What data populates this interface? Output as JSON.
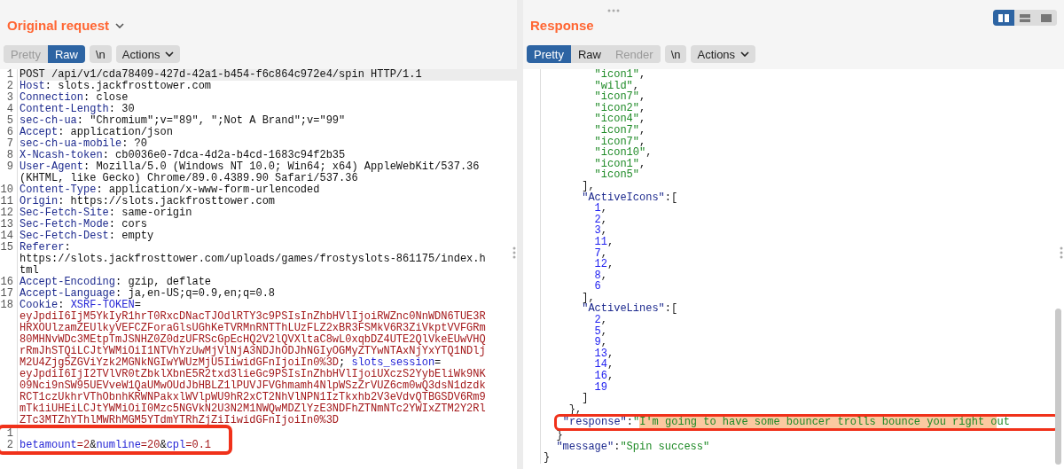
{
  "request": {
    "title": "Original request",
    "tabs": [
      {
        "label": "Pretty",
        "selected": false,
        "disabled": true
      },
      {
        "label": "Raw",
        "selected": true,
        "disabled": false
      }
    ],
    "newline_button": "\\n",
    "actions_button": "Actions",
    "lines": [
      {
        "number": "1",
        "current": true,
        "visual_lines": [
          {
            "segments": [
              {
                "kind": "plain",
                "text": "POST /api/v1/cda78409-427d-42a1-b454-f6c864c972e4/spin HTTP/1.1"
              }
            ]
          }
        ]
      },
      {
        "number": "2",
        "current": false,
        "visual_lines": [
          {
            "segments": [
              {
                "kind": "name",
                "text": "Host"
              },
              {
                "kind": "plain",
                "text": ": slots.jackfrosttower.com"
              }
            ]
          }
        ]
      },
      {
        "number": "3",
        "current": false,
        "visual_lines": [
          {
            "segments": [
              {
                "kind": "name",
                "text": "Connection"
              },
              {
                "kind": "plain",
                "text": ": close"
              }
            ]
          }
        ]
      },
      {
        "number": "4",
        "current": false,
        "visual_lines": [
          {
            "segments": [
              {
                "kind": "name",
                "text": "Content-Length"
              },
              {
                "kind": "plain",
                "text": ": 30"
              }
            ]
          }
        ]
      },
      {
        "number": "5",
        "current": false,
        "visual_lines": [
          {
            "segments": [
              {
                "kind": "name",
                "text": "sec-ch-ua"
              },
              {
                "kind": "plain",
                "text": ": \"Chromium\";v=\"89\", \";Not A Brand\";v=\"99\""
              }
            ]
          }
        ]
      },
      {
        "number": "6",
        "current": false,
        "visual_lines": [
          {
            "segments": [
              {
                "kind": "name",
                "text": "Accept"
              },
              {
                "kind": "plain",
                "text": ": application/json"
              }
            ]
          }
        ]
      },
      {
        "number": "7",
        "current": false,
        "visual_lines": [
          {
            "segments": [
              {
                "kind": "name",
                "text": "sec-ch-ua-mobile"
              },
              {
                "kind": "plain",
                "text": ": ?0"
              }
            ]
          }
        ]
      },
      {
        "number": "8",
        "current": false,
        "visual_lines": [
          {
            "segments": [
              {
                "kind": "name",
                "text": "X-Ncash-token"
              },
              {
                "kind": "plain",
                "text": ": cb0036e0-7dca-4d2a-b4cd-1683c94f2b35"
              }
            ]
          }
        ]
      },
      {
        "number": "9",
        "current": false,
        "visual_lines": [
          {
            "segments": [
              {
                "kind": "name",
                "text": "User-Agent"
              },
              {
                "kind": "plain",
                "text": ": Mozilla/5.0 (Windows NT 10.0; Win64; x64) AppleWebKit/537.36"
              }
            ]
          },
          {
            "segments": [
              {
                "kind": "plain",
                "text": "(KHTML, like Gecko) Chrome/89.0.4389.90 Safari/537.36"
              }
            ]
          }
        ]
      },
      {
        "number": "10",
        "current": false,
        "visual_lines": [
          {
            "segments": [
              {
                "kind": "name",
                "text": "Content-Type"
              },
              {
                "kind": "plain",
                "text": ": application/x-www-form-urlencoded"
              }
            ]
          }
        ]
      },
      {
        "number": "11",
        "current": false,
        "visual_lines": [
          {
            "segments": [
              {
                "kind": "name",
                "text": "Origin"
              },
              {
                "kind": "plain",
                "text": ": https://slots.jackfrosttower.com"
              }
            ]
          }
        ]
      },
      {
        "number": "12",
        "current": false,
        "visual_lines": [
          {
            "segments": [
              {
                "kind": "name",
                "text": "Sec-Fetch-Site"
              },
              {
                "kind": "plain",
                "text": ": same-origin"
              }
            ]
          }
        ]
      },
      {
        "number": "13",
        "current": false,
        "visual_lines": [
          {
            "segments": [
              {
                "kind": "name",
                "text": "Sec-Fetch-Mode"
              },
              {
                "kind": "plain",
                "text": ": cors"
              }
            ]
          }
        ]
      },
      {
        "number": "14",
        "current": false,
        "visual_lines": [
          {
            "segments": [
              {
                "kind": "name",
                "text": "Sec-Fetch-Dest"
              },
              {
                "kind": "plain",
                "text": ": empty"
              }
            ]
          }
        ]
      },
      {
        "number": "15",
        "current": false,
        "visual_lines": [
          {
            "segments": [
              {
                "kind": "name",
                "text": "Referer"
              },
              {
                "kind": "plain",
                "text": ":"
              }
            ]
          },
          {
            "segments": [
              {
                "kind": "plain",
                "text": "https://slots.jackfrosttower.com/uploads/games/frostyslots-861175/index.h"
              }
            ]
          },
          {
            "segments": [
              {
                "kind": "plain",
                "text": "tml"
              }
            ]
          }
        ]
      },
      {
        "number": "16",
        "current": false,
        "visual_lines": [
          {
            "segments": [
              {
                "kind": "name",
                "text": "Accept-Encoding"
              },
              {
                "kind": "plain",
                "text": ": gzip, deflate"
              }
            ]
          }
        ]
      },
      {
        "number": "17",
        "current": false,
        "visual_lines": [
          {
            "segments": [
              {
                "kind": "name",
                "text": "Accept-Language"
              },
              {
                "kind": "plain",
                "text": ": ja,en-US;q=0.9,en;q=0.8"
              }
            ]
          }
        ]
      },
      {
        "number": "18",
        "current": false,
        "visual_lines": [
          {
            "segments": [
              {
                "kind": "name",
                "text": "Cookie"
              },
              {
                "kind": "plain",
                "text": ": "
              },
              {
                "kind": "param",
                "text": "XSRF-TOKEN"
              },
              {
                "kind": "plain",
                "text": "="
              }
            ]
          },
          {
            "segments": [
              {
                "kind": "value",
                "text": "eyJpdiI6IjM5YkIyR1hrT0RxcDNacTJOdlRTY3c9PSIsInZhbHVlIjoiRWZnc0NnWDN6TUE3R"
              }
            ]
          },
          {
            "segments": [
              {
                "kind": "value",
                "text": "HRXOUlzamZEUlkyVEFCZForaGlsUGhKeTVRMnRNTThLUzFLZ2xBR3FSMkV6R3ZiVkptVVFGRm"
              }
            ]
          },
          {
            "segments": [
              {
                "kind": "value",
                "text": "80MHNvWDc3MEtpTmJSNHZ0Z0dzUFRScGpEcHQ2V2lQVXltaC8wL0xqbDZ4UTE2QlVkeEUwVHQ"
              }
            ]
          },
          {
            "segments": [
              {
                "kind": "value",
                "text": "rRmJhSTQiLCJtYWMiOiI1NTVhYzUwMjVlNjA3NDJhODJhNGIyOGMyZTYwNTAxNjYxYTQ1NDlj"
              }
            ]
          },
          {
            "segments": [
              {
                "kind": "value",
                "text": "M2U4Zjg5ZGViYzk2MGNkNGIwYWUzMjU5IiwidGFnIjoiIn0%3D"
              },
              {
                "kind": "plain",
                "text": "; "
              },
              {
                "kind": "param",
                "text": "slots_session"
              },
              {
                "kind": "plain",
                "text": "="
              }
            ]
          },
          {
            "segments": [
              {
                "kind": "value",
                "text": "eyJpdiI6IjI2TVlVR0tZbklXbnE5R2txd3lieGc9PSIsInZhbHVlIjoiUXczS2YybEliWk9NK"
              }
            ]
          },
          {
            "segments": [
              {
                "kind": "value",
                "text": "09Nci9nSW95UEVveW1QaUMwOUdJbHBLZ1lPUVJFVGhmamh4NlpWSzZrVUZ6cm0wQ3dsN1dzdk"
              }
            ]
          },
          {
            "segments": [
              {
                "kind": "value",
                "text": "RCT1czUkhrVThObnhKRWNPakxlWVlpWU9hR2xCT2NhVlNPN1IzTkxhb2V3eVdvQTBGSDV6Rm9"
              }
            ]
          },
          {
            "segments": [
              {
                "kind": "value",
                "text": "mTk1iUHEiLCJtYWMiOiI0Mzc5NGVkN2U3N2M1NWQwMDZlYzE3NDFhZTNmNTc2YWIxZTM2Y2Rl"
              }
            ]
          },
          {
            "segments": [
              {
                "kind": "value",
                "text": "ZTc3MTZhYThlMWRhMGM5YTdmYTRhZjZiIiwidGFnIjoiIn0%3D"
              }
            ]
          }
        ]
      }
    ],
    "boxed_lines": [
      {
        "number": "1"
      },
      {
        "number": "2",
        "visual_lines": [
          {
            "segments": [
              {
                "kind": "param",
                "text": "betamount"
              },
              {
                "kind": "value",
                "text": "=2"
              },
              {
                "kind": "plain",
                "text": "&"
              },
              {
                "kind": "param",
                "text": "numline"
              },
              {
                "kind": "value",
                "text": "=20"
              },
              {
                "kind": "plain",
                "text": "&"
              },
              {
                "kind": "param",
                "text": "cpl"
              },
              {
                "kind": "value",
                "text": "=0.1"
              }
            ]
          }
        ]
      }
    ]
  },
  "response": {
    "title": "Response",
    "view_buttons": [
      {
        "kind": "columns",
        "selected": true
      },
      {
        "kind": "rows",
        "selected": false
      },
      {
        "kind": "single",
        "selected": false
      }
    ],
    "tabs": [
      {
        "label": "Pretty",
        "selected": true,
        "disabled": false
      },
      {
        "label": "Raw",
        "selected": false,
        "disabled": false
      },
      {
        "label": "Render",
        "selected": false,
        "disabled": true
      }
    ],
    "newline_button": "\\n",
    "actions_button": "Actions",
    "nodes": [
      {
        "children": [
          {
            "children": [
              {
                "children": [
                  {
                    "children": [
                      {
                        "segments": [
                          {
                            "kind": "string",
                            "text": "\"icon1\""
                          },
                          {
                            "kind": "punct",
                            "text": ","
                          }
                        ]
                      },
                      {
                        "segments": [
                          {
                            "kind": "string",
                            "text": "\"wild\""
                          },
                          {
                            "kind": "punct",
                            "text": ","
                          }
                        ]
                      },
                      {
                        "segments": [
                          {
                            "kind": "string",
                            "text": "\"icon7\""
                          },
                          {
                            "kind": "punct",
                            "text": ","
                          }
                        ]
                      },
                      {
                        "segments": [
                          {
                            "kind": "string",
                            "text": "\"icon2\""
                          },
                          {
                            "kind": "punct",
                            "text": ","
                          }
                        ]
                      },
                      {
                        "segments": [
                          {
                            "kind": "string",
                            "text": "\"icon4\""
                          },
                          {
                            "kind": "punct",
                            "text": ","
                          }
                        ]
                      },
                      {
                        "segments": [
                          {
                            "kind": "string",
                            "text": "\"icon7\""
                          },
                          {
                            "kind": "punct",
                            "text": ","
                          }
                        ]
                      },
                      {
                        "segments": [
                          {
                            "kind": "string",
                            "text": "\"icon7\""
                          },
                          {
                            "kind": "punct",
                            "text": ","
                          }
                        ]
                      },
                      {
                        "segments": [
                          {
                            "kind": "string",
                            "text": "\"icon10\""
                          },
                          {
                            "kind": "punct",
                            "text": ","
                          }
                        ]
                      },
                      {
                        "segments": [
                          {
                            "kind": "string",
                            "text": "\"icon1\""
                          },
                          {
                            "kind": "punct",
                            "text": ","
                          }
                        ]
                      },
                      {
                        "segments": [
                          {
                            "kind": "string",
                            "text": "\"icon5\""
                          }
                        ]
                      }
                    ]
                  },
                  {
                    "segments": [
                      {
                        "kind": "punct",
                        "text": "],"
                      }
                    ]
                  },
                  {
                    "segments": [
                      {
                        "kind": "key",
                        "text": "\"ActiveIcons\""
                      },
                      {
                        "kind": "punct",
                        "text": ":["
                      }
                    ],
                    "children": [
                      {
                        "segments": [
                          {
                            "kind": "number",
                            "text": "1"
                          },
                          {
                            "kind": "punct",
                            "text": ","
                          }
                        ]
                      },
                      {
                        "segments": [
                          {
                            "kind": "number",
                            "text": "2"
                          },
                          {
                            "kind": "punct",
                            "text": ","
                          }
                        ]
                      },
                      {
                        "segments": [
                          {
                            "kind": "number",
                            "text": "3"
                          },
                          {
                            "kind": "punct",
                            "text": ","
                          }
                        ]
                      },
                      {
                        "segments": [
                          {
                            "kind": "number",
                            "text": "11"
                          },
                          {
                            "kind": "punct",
                            "text": ","
                          }
                        ]
                      },
                      {
                        "segments": [
                          {
                            "kind": "number",
                            "text": "7"
                          },
                          {
                            "kind": "punct",
                            "text": ","
                          }
                        ]
                      },
                      {
                        "segments": [
                          {
                            "kind": "number",
                            "text": "12"
                          },
                          {
                            "kind": "punct",
                            "text": ","
                          }
                        ]
                      },
                      {
                        "segments": [
                          {
                            "kind": "number",
                            "text": "8"
                          },
                          {
                            "kind": "punct",
                            "text": ","
                          }
                        ]
                      },
                      {
                        "segments": [
                          {
                            "kind": "number",
                            "text": "6"
                          }
                        ]
                      }
                    ]
                  },
                  {
                    "segments": [
                      {
                        "kind": "punct",
                        "text": "],"
                      }
                    ]
                  },
                  {
                    "segments": [
                      {
                        "kind": "key",
                        "text": "\"ActiveLines\""
                      },
                      {
                        "kind": "punct",
                        "text": ":["
                      }
                    ],
                    "children": [
                      {
                        "segments": [
                          {
                            "kind": "number",
                            "text": "2"
                          },
                          {
                            "kind": "punct",
                            "text": ","
                          }
                        ]
                      },
                      {
                        "segments": [
                          {
                            "kind": "number",
                            "text": "5"
                          },
                          {
                            "kind": "punct",
                            "text": ","
                          }
                        ]
                      },
                      {
                        "segments": [
                          {
                            "kind": "number",
                            "text": "9"
                          },
                          {
                            "kind": "punct",
                            "text": ","
                          }
                        ]
                      },
                      {
                        "segments": [
                          {
                            "kind": "number",
                            "text": "13"
                          },
                          {
                            "kind": "punct",
                            "text": ","
                          }
                        ]
                      },
                      {
                        "segments": [
                          {
                            "kind": "number",
                            "text": "14"
                          },
                          {
                            "kind": "punct",
                            "text": ","
                          }
                        ]
                      },
                      {
                        "segments": [
                          {
                            "kind": "number",
                            "text": "16"
                          },
                          {
                            "kind": "punct",
                            "text": ","
                          }
                        ]
                      },
                      {
                        "segments": [
                          {
                            "kind": "number",
                            "text": "19"
                          }
                        ]
                      }
                    ]
                  },
                  {
                    "segments": [
                      {
                        "kind": "punct",
                        "text": "]"
                      }
                    ]
                  }
                ]
              },
              {
                "segments": [
                  {
                    "kind": "punct",
                    "text": "},"
                  }
                ]
              },
              {
                "boxed": true,
                "segments": [
                  {
                    "kind": "key",
                    "text": "\"response\""
                  },
                  {
                    "kind": "punct",
                    "text": ":"
                  },
                  {
                    "kind": "string",
                    "text": "\""
                  },
                  {
                    "kind": "selection",
                    "text": "I'm going to have some bouncer trolls bounce you right o"
                  },
                  {
                    "kind": "string",
                    "text": "ut"
                  }
                ]
              }
            ]
          },
          {
            "segments": [
              {
                "kind": "punct",
                "text": "}"
              }
            ]
          },
          {
            "segments": [
              {
                "kind": "key",
                "text": "\"message\""
              },
              {
                "kind": "punct",
                "text": ":"
              },
              {
                "kind": "string",
                "text": "\"Spin success\""
              }
            ]
          }
        ]
      },
      {
        "segments": [
          {
            "kind": "punct",
            "text": "}"
          }
        ]
      }
    ]
  }
}
